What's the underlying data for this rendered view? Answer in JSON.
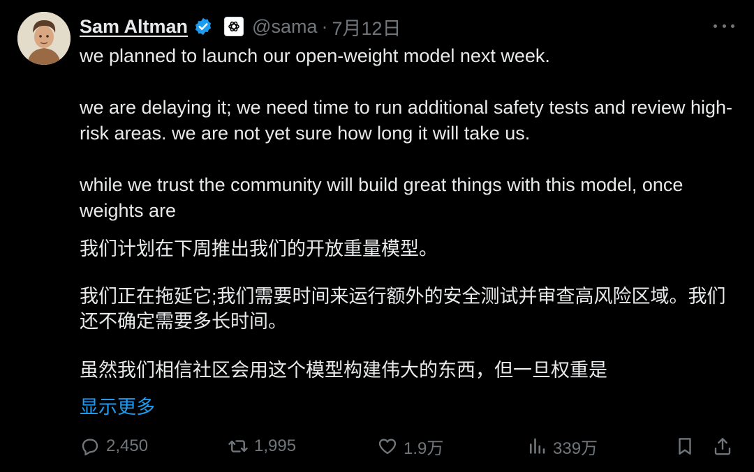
{
  "author": {
    "name": "Sam Altman",
    "handle": "@sama",
    "separator": "·",
    "date": "7月12日",
    "verified_icon": "verified-badge-icon",
    "affiliation_icon": "openai-logo-icon"
  },
  "tweet": {
    "paragraph_1": "we planned to launch our open-weight model next week.",
    "paragraph_2": "we are delaying it; we need time to run additional safety tests and review high-risk areas. we are not yet sure how long it will take us.",
    "paragraph_3": "while we trust the community will build great things with this model, once weights are",
    "translation_1": "我们计划在下周推出我们的开放重量模型。",
    "translation_2": "我们正在拖延它;我们需要时间来运行额外的安全测试并审查高风险区域。我们还不确定需要多长时间。",
    "translation_3": "虽然我们相信社区会用这个模型构建伟大的东西，但一旦权重是",
    "show_more": "显示更多"
  },
  "actions": {
    "replies": "2,450",
    "reposts": "1,995",
    "likes": "1.9万",
    "views": "339万"
  },
  "colors": {
    "background": "#000000",
    "text": "#e7e9ea",
    "muted": "#71767b",
    "link": "#1d9bf0",
    "verified": "#1d9bf0"
  }
}
